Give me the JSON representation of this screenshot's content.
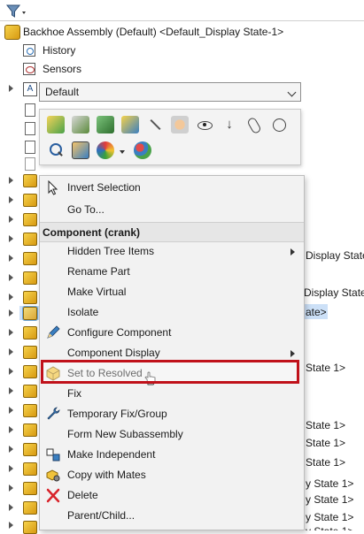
{
  "filter": {
    "icon": "funnel-icon"
  },
  "tree": {
    "root_label": "Backhoe Assembly (Default) <Default_Display State-1>",
    "history_label": "History",
    "sensors_label": "Sensors",
    "right_fragments": {
      "f1": "Display State-",
      "f2": "Display State>",
      "f3": "ate>",
      "f4": "State 1>",
      "f5": "State 1>",
      "f6": "State 1>",
      "f7": "State 1>",
      "f8": "y State 1>",
      "f9": "y State 1>",
      "f10": "y State 1>",
      "f11": "y State 1>"
    }
  },
  "dropdown": {
    "value": "Default"
  },
  "toolbar": {
    "row1": [
      "open-part-icon",
      "edit-part-icon",
      "open-assembly-icon",
      "edit-config-icon",
      "hide-icon",
      "show-icon",
      "sort-icon",
      "paperclip-icon",
      "mates-icon",
      "properties-icon"
    ],
    "row2": [
      "zoom-to-selection-icon",
      "view-icon",
      "appearance-icon",
      "display-states-icon"
    ]
  },
  "menu": {
    "invert_selection": "Invert Selection",
    "go_to": "Go To...",
    "section_header": "Component (crank)",
    "hidden_tree_items": "Hidden Tree Items",
    "rename_part": "Rename Part",
    "make_virtual": "Make Virtual",
    "isolate": "Isolate",
    "configure_component": "Configure Component",
    "component_display": "Component Display",
    "set_to_resolved": "Set to Resolved",
    "fix": "Fix",
    "temporary_fix_group": "Temporary Fix/Group",
    "form_new_subassembly": "Form New Subassembly",
    "make_independent": "Make Independent",
    "copy_with_mates": "Copy with Mates",
    "delete": "Delete",
    "parent_child": "Parent/Child..."
  },
  "colors": {
    "highlight_border": "#c0111a",
    "part_yellow": "#e8b624",
    "selection_blue": "#cce0f7"
  }
}
